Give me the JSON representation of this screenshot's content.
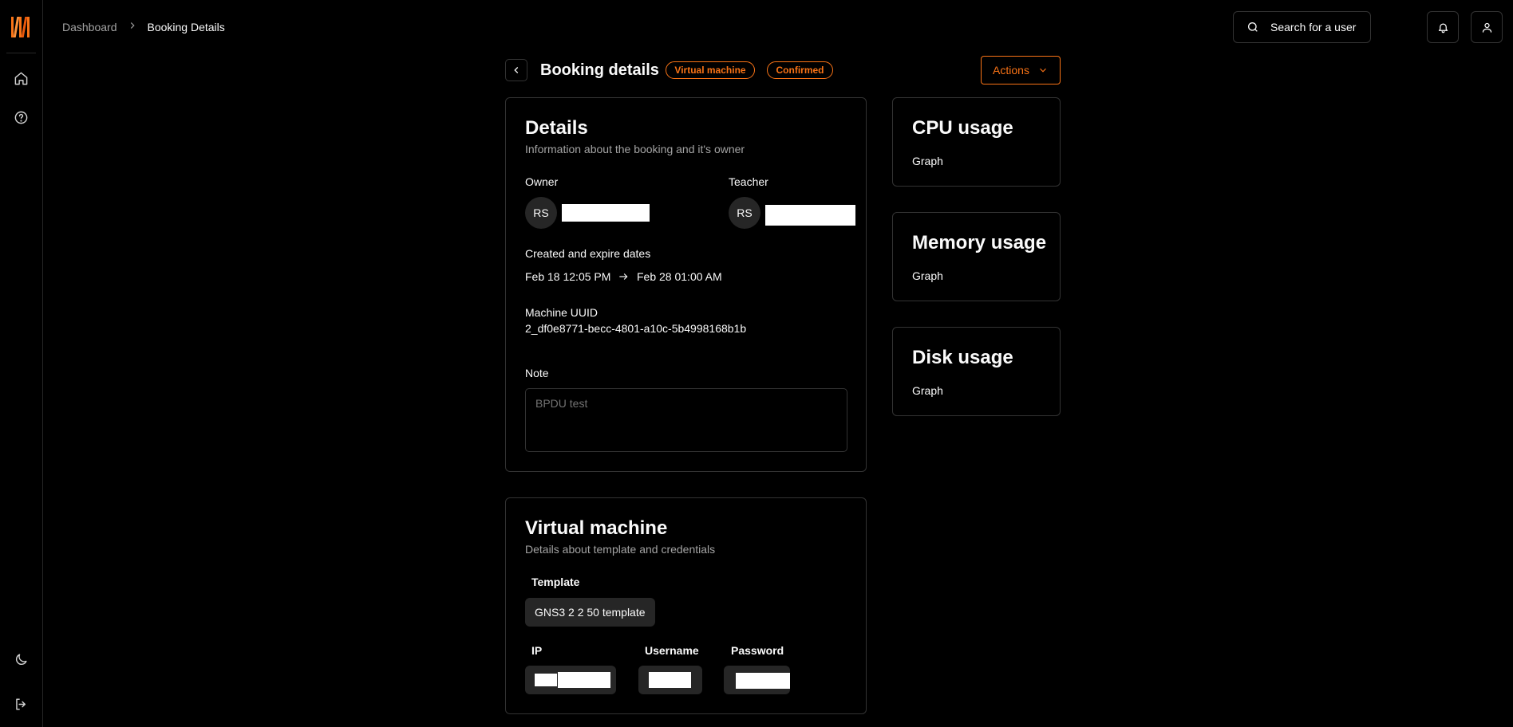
{
  "sidebar": {
    "icons": [
      "home-icon",
      "help-icon",
      "moon-icon",
      "logout-icon"
    ]
  },
  "breadcrumb": {
    "parent": "Dashboard",
    "current": "Booking Details"
  },
  "header": {
    "search_label": "Search for a user"
  },
  "page": {
    "title": "Booking details",
    "badges": [
      "Virtual machine",
      "Confirmed"
    ],
    "actions_label": "Actions",
    "accent_color": "#f97316"
  },
  "details": {
    "title": "Details",
    "subtitle": "Information about the booking and it's owner",
    "owner_label": "Owner",
    "owner_initials": "RS",
    "teacher_label": "Teacher",
    "teacher_initials": "RS",
    "dates_label": "Created and expire dates",
    "created": "Feb 18 12:05 PM",
    "expires": "Feb 28 01:00 AM",
    "uuid_label": "Machine UUID",
    "uuid": "2_df0e8771-becc-4801-a10c-5b4998168b1b",
    "note_label": "Note",
    "note_placeholder": "BPDU test"
  },
  "vm": {
    "title": "Virtual machine",
    "subtitle": "Details about template and credentials",
    "template_label": "Template",
    "template": "GNS3 2 2 50 template",
    "ip_label": "IP",
    "username_label": "Username",
    "password_label": "Password"
  },
  "usage": {
    "cpu_title": "CPU usage",
    "cpu_body": "Graph",
    "memory_title": "Memory usage",
    "memory_body": "Graph",
    "disk_title": "Disk usage",
    "disk_body": "Graph"
  }
}
